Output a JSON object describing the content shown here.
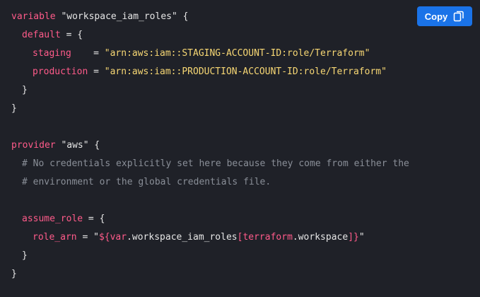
{
  "toolbar": {
    "copy_label": "Copy",
    "copy_icon": "copy-icon"
  },
  "code": {
    "line1": {
      "keyword": "variable",
      "name": "\"workspace_iam_roles\"",
      "brace": " {"
    },
    "line2": {
      "key": "default",
      "rest": " = {"
    },
    "line3": {
      "key": "staging",
      "eq": "    = ",
      "value": "\"arn:aws:iam::STAGING-ACCOUNT-ID:role/Terraform\""
    },
    "line4": {
      "key": "production",
      "eq": " = ",
      "value": "\"arn:aws:iam::PRODUCTION-ACCOUNT-ID:role/Terraform\""
    },
    "line5": {
      "text": "}"
    },
    "line6": {
      "text": "}"
    },
    "line8": {
      "keyword": "provider",
      "name": "\"aws\"",
      "brace": " {"
    },
    "line9": {
      "text": "# No credentials explicitly set here because they come from either the"
    },
    "line10": {
      "text": "# environment or the global credentials file."
    },
    "line12": {
      "key": "assume_role",
      "rest": " = {"
    },
    "line13": {
      "key": "role_arn",
      "eq": " = ",
      "q1": "\"",
      "interp_open": "${",
      "var": "var",
      "dot1": ".workspace_iam_roles",
      "bracket_open": "[",
      "tf": "terraform",
      "dot2": ".workspace",
      "bracket_close": "]",
      "interp_close": "}",
      "q2": "\""
    },
    "line14": {
      "text": "}"
    },
    "line15": {
      "text": "}"
    }
  },
  "colors": {
    "background": "#1f2128",
    "keyword": "#ff5b8a",
    "string": "#f7d774",
    "comment": "#8a8f98",
    "button": "#1a73e8"
  }
}
